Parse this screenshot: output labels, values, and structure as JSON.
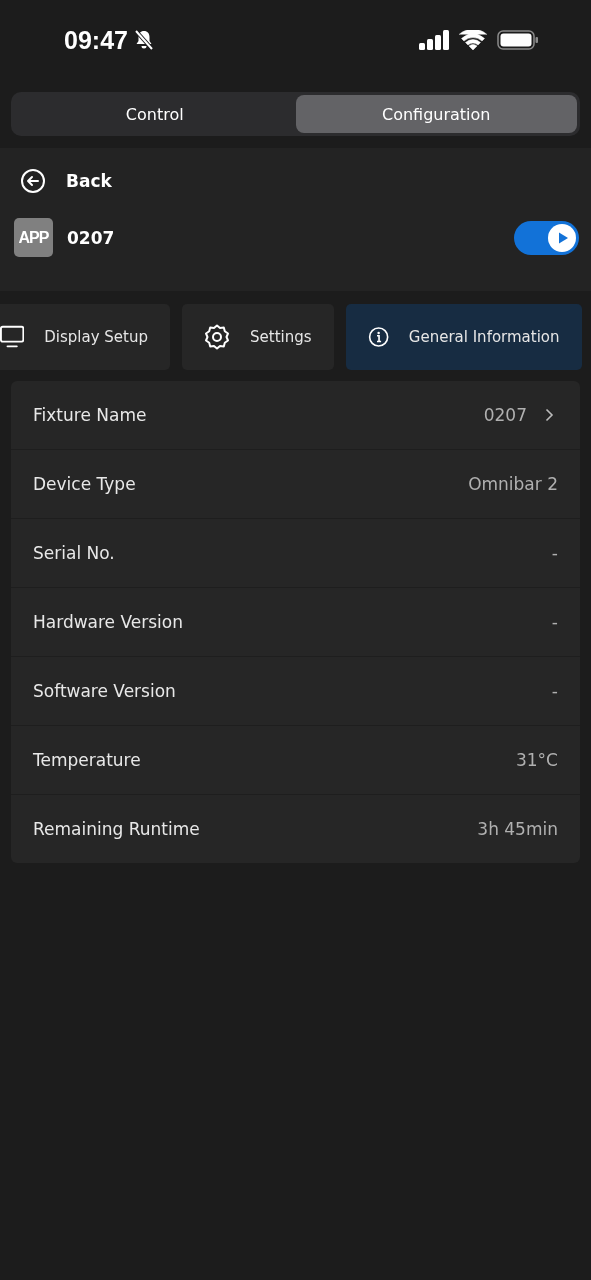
{
  "status_bar": {
    "time": "09:47",
    "muted": true
  },
  "segments": [
    {
      "label": "Control",
      "selected": false
    },
    {
      "label": "Configuration",
      "selected": true
    }
  ],
  "back": {
    "label": "Back"
  },
  "device": {
    "badge": "APP",
    "name": "0207",
    "on": true
  },
  "menu": [
    {
      "label": "Display Setup",
      "kind": "display",
      "selected": false
    },
    {
      "label": "Settings",
      "kind": "gear",
      "selected": false
    },
    {
      "label": "General Information",
      "kind": "info",
      "selected": true
    }
  ],
  "rows": [
    {
      "label": "Fixture Name",
      "value": "0207",
      "kind": "link"
    },
    {
      "label": "Device Type",
      "value": "Omnibar 2",
      "kind": "info"
    },
    {
      "label": "Serial No.",
      "value": "-",
      "kind": "info"
    },
    {
      "label": "Hardware Version",
      "value": "-",
      "kind": "info"
    },
    {
      "label": "Software Version",
      "value": "-",
      "kind": "info"
    },
    {
      "label": "Temperature",
      "value": "31°C",
      "kind": "info"
    },
    {
      "label": "Remaining Runtime",
      "value": "3h 45min",
      "kind": "info"
    }
  ]
}
